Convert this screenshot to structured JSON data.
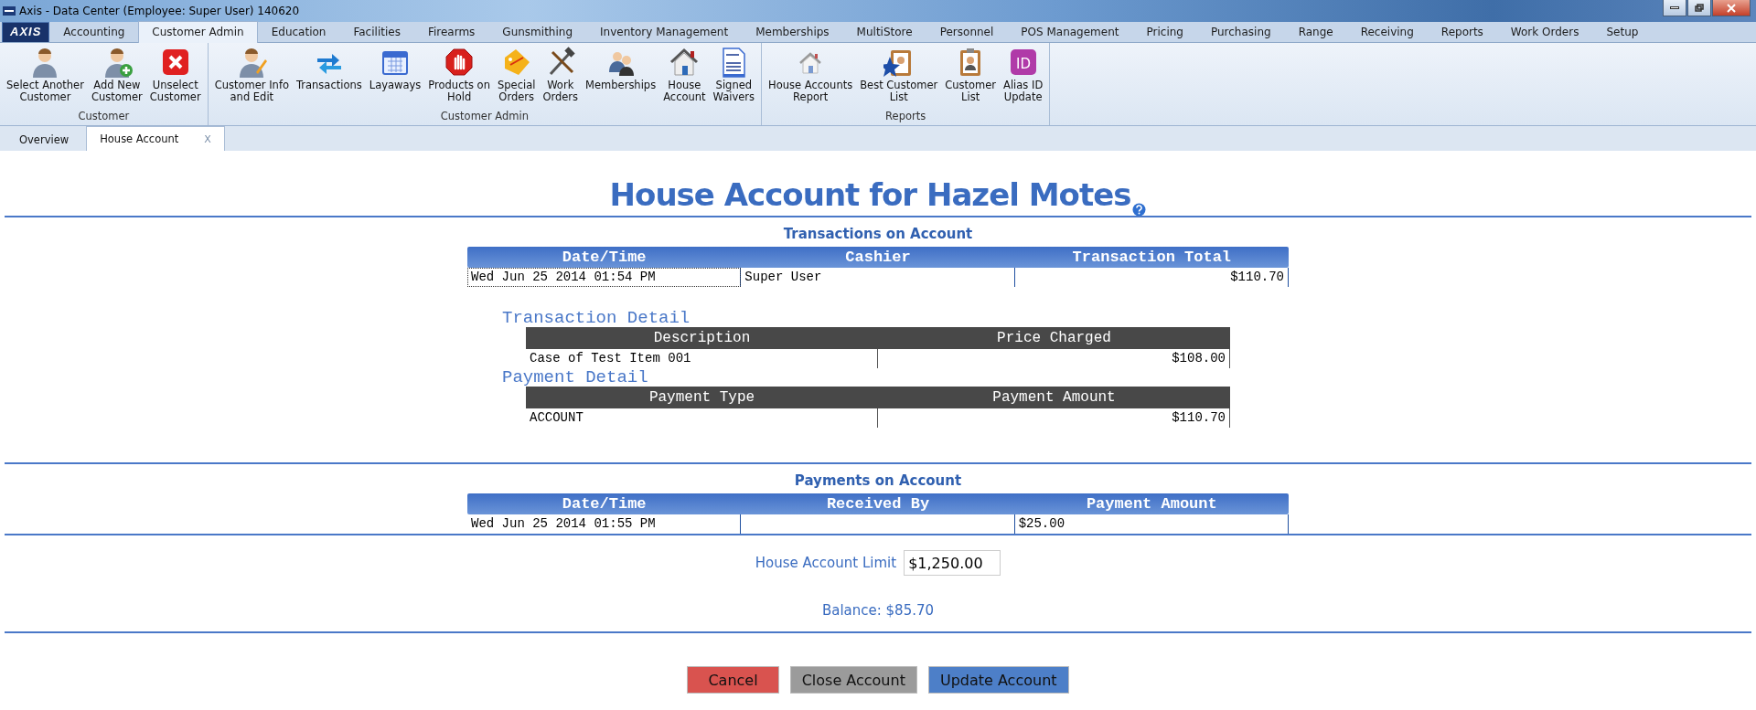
{
  "window": {
    "title": "Axis - Data Center  (Employee: Super User) 140620"
  },
  "menu": {
    "logo": "AXIS",
    "tabs": [
      {
        "label": "Accounting",
        "selected": false
      },
      {
        "label": "Customer Admin",
        "selected": true
      },
      {
        "label": "Education",
        "selected": false
      },
      {
        "label": "Facilities",
        "selected": false
      },
      {
        "label": "Firearms",
        "selected": false
      },
      {
        "label": "Gunsmithing",
        "selected": false
      },
      {
        "label": "Inventory Management",
        "selected": false
      },
      {
        "label": "Memberships",
        "selected": false
      },
      {
        "label": "MultiStore",
        "selected": false
      },
      {
        "label": "Personnel",
        "selected": false
      },
      {
        "label": "POS Management",
        "selected": false
      },
      {
        "label": "Pricing",
        "selected": false
      },
      {
        "label": "Purchasing",
        "selected": false
      },
      {
        "label": "Range",
        "selected": false
      },
      {
        "label": "Receiving",
        "selected": false
      },
      {
        "label": "Reports",
        "selected": false
      },
      {
        "label": "Work Orders",
        "selected": false
      },
      {
        "label": "Setup",
        "selected": false
      }
    ]
  },
  "ribbon": {
    "groups": [
      {
        "label": "Customer",
        "buttons": [
          {
            "label": "Select Another\nCustomer"
          },
          {
            "label": "Add New\nCustomer"
          },
          {
            "label": "Unselect\nCustomer"
          }
        ]
      },
      {
        "label": "Customer Admin",
        "buttons": [
          {
            "label": "Customer Info\nand Edit"
          },
          {
            "label": "Transactions"
          },
          {
            "label": "Layaways"
          },
          {
            "label": "Products on\nHold"
          },
          {
            "label": "Special\nOrders"
          },
          {
            "label": "Work\nOrders"
          },
          {
            "label": "Memberships"
          },
          {
            "label": "House\nAccount"
          },
          {
            "label": "Signed\nWaivers"
          }
        ]
      },
      {
        "label": "Reports",
        "buttons": [
          {
            "label": "House Accounts\nReport"
          },
          {
            "label": "Best Customer\nList"
          },
          {
            "label": "Customer\nList"
          },
          {
            "label": "Alias ID\nUpdate",
            "badge": "ID"
          }
        ]
      }
    ]
  },
  "doc_tabs": [
    {
      "label": "Overview",
      "selected": false
    },
    {
      "label": "House Account",
      "selected": true,
      "close": "X"
    }
  ],
  "page": {
    "title": "House Account for Hazel Motes",
    "transactions": {
      "heading": "Transactions on Account",
      "columns": [
        "Date/Time",
        "Cashier",
        "Transaction Total"
      ],
      "rows": [
        {
          "cells": [
            "Wed Jun 25 2014 01:54 PM",
            "Super User",
            "$110.70"
          ]
        }
      ]
    },
    "transaction_detail": {
      "heading": "Transaction Detail",
      "columns": [
        "Description",
        "Price Charged"
      ],
      "rows": [
        {
          "cells": [
            "Case of Test Item 001",
            "$108.00"
          ]
        }
      ]
    },
    "payment_detail": {
      "heading": "Payment Detail",
      "columns": [
        "Payment Type",
        "Payment Amount"
      ],
      "rows": [
        {
          "cells": [
            "ACCOUNT",
            "$110.70"
          ]
        }
      ]
    },
    "payments": {
      "heading": "Payments on Account",
      "columns": [
        "Date/Time",
        "Received By",
        "Payment Amount"
      ],
      "rows": [
        {
          "cells": [
            "Wed Jun 25 2014 01:55 PM",
            "",
            "$25.00"
          ]
        }
      ]
    },
    "limit": {
      "label": "House Account Limit",
      "value": "$1,250.00"
    },
    "balance": "Balance: $85.70",
    "buttons": [
      {
        "label": "Cancel",
        "kind": "danger"
      },
      {
        "label": "Close Account",
        "kind": "neutral"
      },
      {
        "label": "Update Account",
        "kind": "primary"
      }
    ]
  }
}
